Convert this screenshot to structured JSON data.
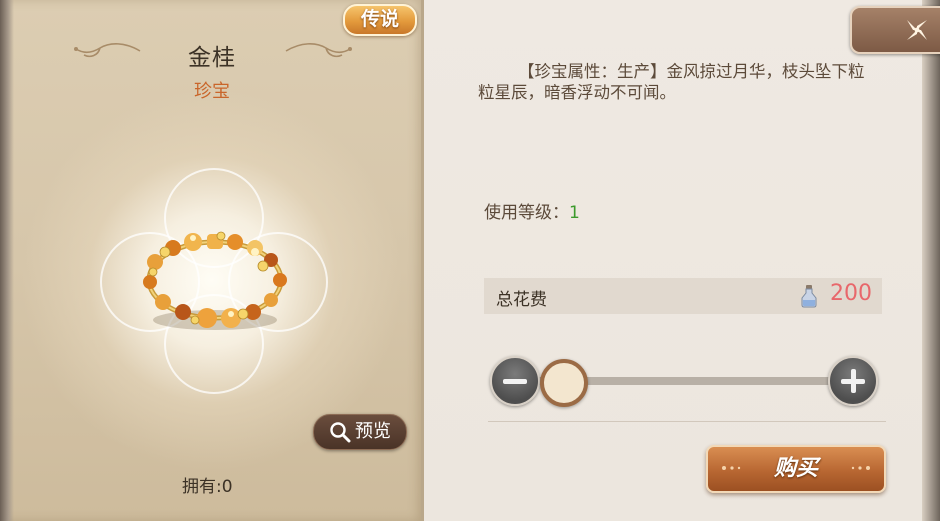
{
  "item": {
    "rarity": "传说",
    "name": "金桂",
    "type": "珍宝",
    "owned": "拥有:0",
    "preview_label": "预览"
  },
  "detail": {
    "description": "【珍宝属性：生产】金风掠过月华，枝头坠下粒粒星辰，暗香浮动不可闻。",
    "level_label": "使用等级：",
    "level_value": "1",
    "cost_label": "总花费",
    "cost_value": "200",
    "buy_label": "购买"
  },
  "colors": {
    "rarity_badge": "#e39a3c",
    "item_type": "#c9652a",
    "level_value": "#3c9a2c",
    "cost_value": "#e8676b",
    "buy_button": "#b86732"
  },
  "icons": {
    "close": "close-icon",
    "preview": "magnifier-icon",
    "cost": "potion-bottle-icon",
    "decrease": "minus-icon",
    "increase": "plus-icon"
  }
}
